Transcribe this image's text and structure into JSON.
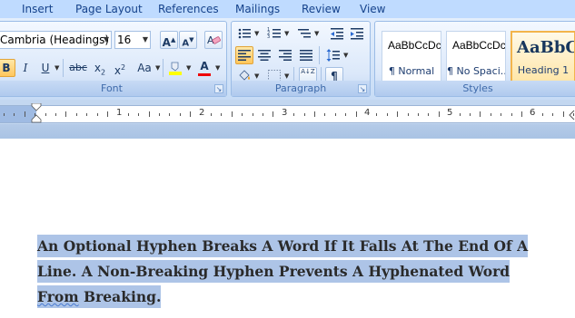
{
  "tabs": [
    "Insert",
    "Page Layout",
    "References",
    "Mailings",
    "Review",
    "View"
  ],
  "font_group": {
    "font_name": "Cambria (Headings)",
    "font_size": "16",
    "grow_label": "A",
    "shrink_label": "A",
    "bold": "B",
    "italic": "I",
    "underline": "U",
    "strikethrough": "abc",
    "subscript": "x",
    "subscript_mark": "2",
    "superscript": "x",
    "superscript_mark": "2",
    "change_case": "Aa",
    "font_color": "A",
    "label": "Font"
  },
  "paragraph_group": {
    "sort_icon": "A↓Z",
    "pilcrow": "¶",
    "label": "Paragraph"
  },
  "styles_group": {
    "styles": [
      {
        "sample": "AaBbCcDc",
        "name": "¶ Normal"
      },
      {
        "sample": "AaBbCcDc",
        "name": "¶ No Spaci..."
      },
      {
        "sample": "AaBbC",
        "name": "Heading 1"
      }
    ],
    "label": "Styles"
  },
  "ruler": {
    "numbers": [
      "1",
      "2",
      "3",
      "4",
      "5",
      "6"
    ]
  },
  "document": {
    "line1": " An Optional Hyphen Breaks A Word If It Falls At The End Of A",
    "line2": "Line. A Non-Breaking Hyphen Prevents A Hyphenated Word",
    "line3_first": "From",
    "line3_rest": " Breaking."
  },
  "colors": {
    "highlight": "#adc4e7",
    "ribbon": "#dbe8fa",
    "accent": "#15428b"
  }
}
